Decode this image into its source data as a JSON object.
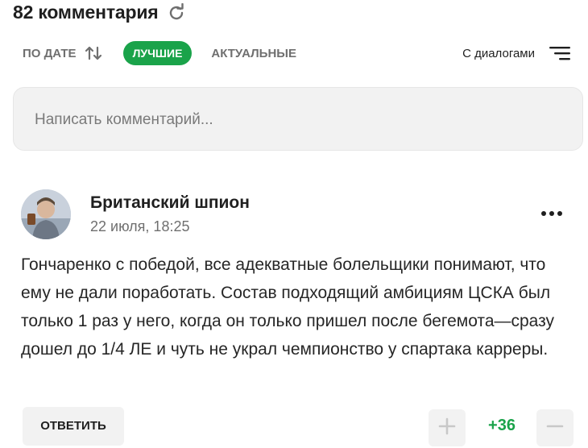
{
  "header": {
    "title": "82 комментария"
  },
  "sort": {
    "by_date_label": "ПО ДАТЕ",
    "best_label": "ЛУЧШИЕ",
    "actual_label": "АКТУАЛЬНЫЕ",
    "dialogs_label": "С диалогами"
  },
  "comment_input": {
    "placeholder": "Написать комментарий..."
  },
  "comment": {
    "author": "Британский шпион",
    "date": "22 июля, 18:25",
    "text": "Гончаренко с победой, все адекватные болельщики понимают, что ему не дали поработать. Состав подходящий амбициям ЦСКА был только 1 раз у него, когда он только пришел после бегемота—сразу дошел до 1/4 ЛЕ и чуть не украл чемпионство у спартака карреры.",
    "reply_label": "ОТВЕТИТЬ",
    "score": "+36"
  },
  "colors": {
    "accent": "#1aa34a",
    "muted": "#6f6f6f",
    "surface": "#f2f2f2"
  },
  "icons": [
    "refresh-icon",
    "sort-arrows-icon",
    "dialogs-menu-icon",
    "more-dots-icon",
    "plus-icon",
    "minus-icon"
  ]
}
